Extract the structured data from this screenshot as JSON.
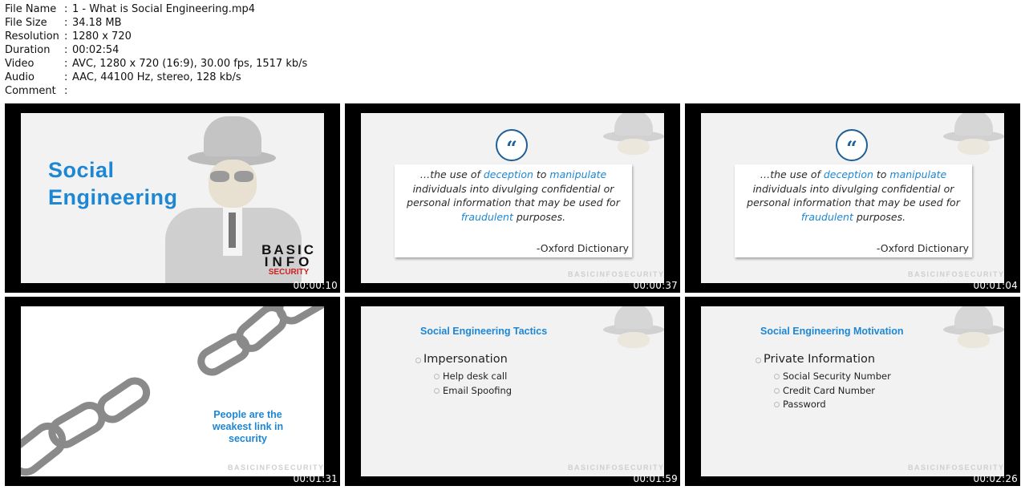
{
  "meta": {
    "rows": [
      {
        "key": "File Name",
        "value": "1 - What is Social Engineering.mp4"
      },
      {
        "key": "File Size",
        "value": "34.18 MB"
      },
      {
        "key": "Resolution",
        "value": "1280 x 720"
      },
      {
        "key": "Duration",
        "value": "00:02:54"
      },
      {
        "key": "Video",
        "value": "AVC, 1280 x 720 (16:9), 30.00 fps, 1517 kb/s"
      },
      {
        "key": "Audio",
        "value": "AAC, 44100 Hz, stereo, 128 kb/s"
      },
      {
        "key": "Comment",
        "value": ""
      }
    ],
    "separator": ":"
  },
  "thumbnails": [
    {
      "timestamp": "00:00:10",
      "title_line1": "Social",
      "title_line2": "Engineering",
      "logo_basic": "BASIC",
      "logo_info": "INFO",
      "logo_security": "SECURITY"
    },
    {
      "timestamp": "00:00:37",
      "quote_icon": "“",
      "q1": "…the use of ",
      "q_deception": "deception",
      "q2": " to ",
      "q_manipulate": "manipulate",
      "q3": " individuals into divulging confidential or personal information that may be used for ",
      "q_fraudulent": "fraudulent",
      "q4": " purposes.",
      "source": "-Oxford Dictionary",
      "watermark": "BASICINFOSECURITY"
    },
    {
      "timestamp": "00:01:04",
      "quote_icon": "“",
      "q1": "…the use of ",
      "q_deception": "deception",
      "q2": " to ",
      "q_manipulate": "manipulate",
      "q3": " individuals into divulging confidential or personal information that may be used for ",
      "q_fraudulent": "fraudulent",
      "q4": " purposes.",
      "source": "-Oxford Dictionary",
      "watermark": "BASICINFOSECURITY"
    },
    {
      "timestamp": "00:01:31",
      "caption": "People are the weakest link in security",
      "watermark": "BASICINFOSECURITY"
    },
    {
      "timestamp": "00:01:59",
      "title": "Social Engineering Tactics",
      "main": "Impersonation",
      "subs": [
        "Help desk call",
        "Email Spoofing"
      ],
      "watermark": "BASICINFOSECURITY"
    },
    {
      "timestamp": "00:02:26",
      "title": "Social Engineering Motivation",
      "main": "Private Information",
      "subs": [
        "Social Security Number",
        "Credit Card Number",
        "Password"
      ],
      "watermark": "BASICINFOSECURITY"
    }
  ],
  "colors": {
    "accent": "#1d87d4",
    "logo_red": "#d01f1f",
    "frame": "#000000"
  },
  "icons": {
    "spy": "spy-silhouette-icon",
    "quote": "quote-mark-icon",
    "chain": "broken-chain-icon"
  }
}
